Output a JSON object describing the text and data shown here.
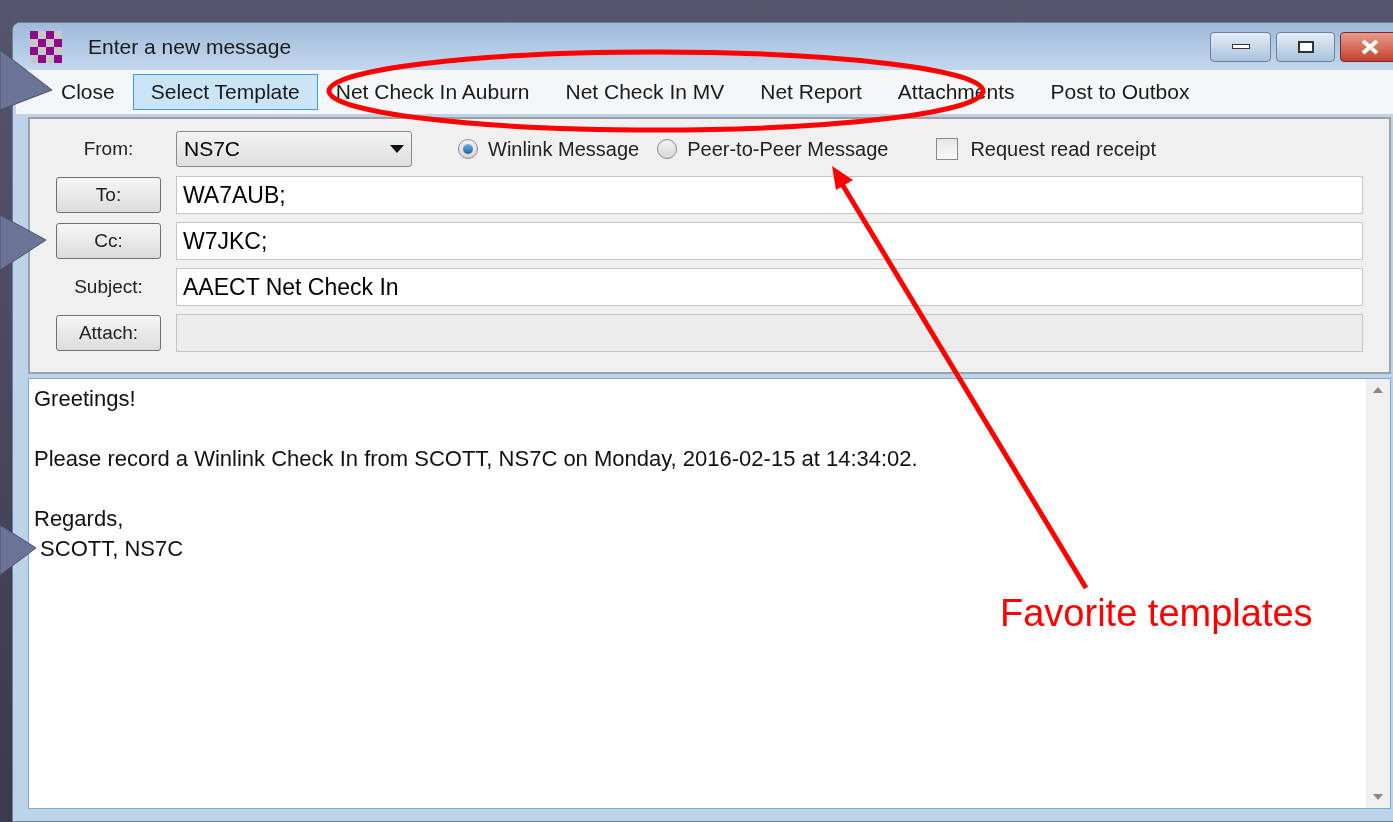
{
  "window": {
    "title": "Enter a new message"
  },
  "menu": [
    {
      "label": "Close",
      "selected": false
    },
    {
      "label": "Select Template",
      "selected": true
    },
    {
      "label": "Net Check In Auburn",
      "selected": false
    },
    {
      "label": "Net Check In MV",
      "selected": false
    },
    {
      "label": "Net Report",
      "selected": false
    },
    {
      "label": "Attachments",
      "selected": false
    },
    {
      "label": "Post to Outbox",
      "selected": false
    }
  ],
  "from": {
    "label": "From:",
    "value": "NS7C"
  },
  "message_types": [
    {
      "label": "Winlink Message",
      "selected": true
    },
    {
      "label": "Peer-to-Peer Message",
      "selected": false
    }
  ],
  "read_receipt": {
    "label": "Request read receipt",
    "checked": false
  },
  "fields": [
    {
      "kind": "button",
      "label": "To:",
      "value": "WA7AUB;"
    },
    {
      "kind": "button",
      "label": "Cc:",
      "value": "W7JKC;"
    },
    {
      "kind": "text",
      "label": "Subject:",
      "value": "AAECT Net Check In"
    },
    {
      "kind": "button",
      "label": "Attach:",
      "disabled": true
    }
  ],
  "body": {
    "paragraphs": [
      [
        "Greetings!"
      ],
      [
        "Please record a Winlink Check In from SCOTT, NS7C on Monday, 2016-02-15 at 14:34:02."
      ],
      [
        "Regards,",
        " SCOTT, NS7C"
      ]
    ]
  },
  "annotation": {
    "label": "Favorite templates"
  }
}
